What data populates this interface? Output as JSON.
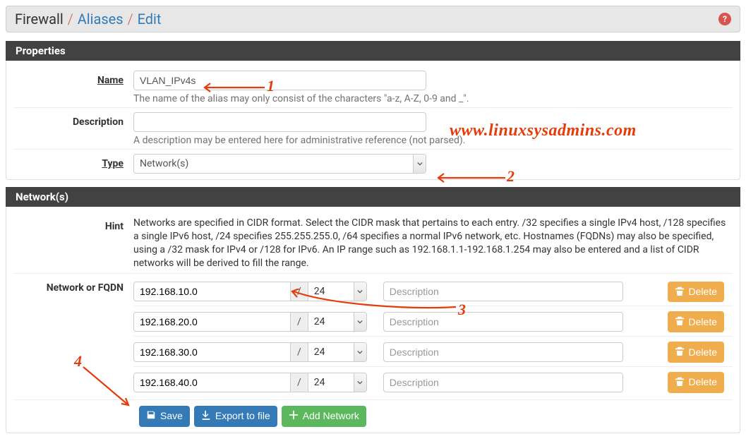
{
  "breadcrumb": {
    "root": "Firewall",
    "sep": "/",
    "link": "Aliases",
    "current": "Edit"
  },
  "help_badge": "?",
  "panels": {
    "properties_title": "Properties",
    "name": {
      "label": "Name",
      "value": "VLAN_IPv4s",
      "help": "The name of the alias may only consist of the characters \"a-z, A-Z, 0-9 and _\"."
    },
    "description": {
      "label": "Description",
      "value": "",
      "help": "A description may be entered here for administrative reference (not parsed)."
    },
    "type": {
      "label": "Type",
      "value": "Network(s)"
    },
    "networks_title": "Network(s)",
    "hint": {
      "label": "Hint",
      "text": "Networks are specified in CIDR format. Select the CIDR mask that pertains to each entry. /32 specifies a single IPv4 host, /128 specifies a single IPv6 host, /24 specifies 255.255.255.0, /64 specifies a normal IPv6 network, etc. Hostnames (FQDNs) may also be specified, using a /32 mask for IPv4 or /128 for IPv6. An IP range such as 192.168.1.1-192.168.1.254 may also be entered and a list of CIDR networks will be derived to fill the range."
    },
    "network_label": "Network or FQDN",
    "slash": "/",
    "entries": [
      {
        "addr": "192.168.10.0",
        "cidr": "24",
        "desc_placeholder": "Description"
      },
      {
        "addr": "192.168.20.0",
        "cidr": "24",
        "desc_placeholder": "Description"
      },
      {
        "addr": "192.168.30.0",
        "cidr": "24",
        "desc_placeholder": "Description"
      },
      {
        "addr": "192.168.40.0",
        "cidr": "24",
        "desc_placeholder": "Description"
      }
    ],
    "delete_label": "Delete"
  },
  "actions": {
    "save": "Save",
    "export": "Export to file",
    "add": "Add Network"
  },
  "annotations": {
    "n1": "1",
    "n2": "2",
    "n3": "3",
    "n4": "4",
    "watermark": "www.linuxsysadmins.com"
  }
}
